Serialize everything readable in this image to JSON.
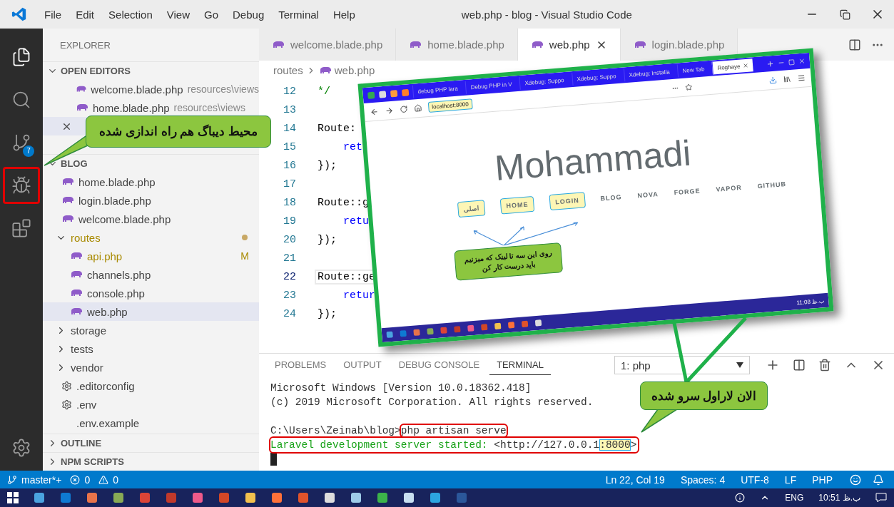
{
  "title_bar": {
    "menu": [
      "File",
      "Edit",
      "Selection",
      "View",
      "Go",
      "Debug",
      "Terminal",
      "Help"
    ],
    "title": "web.php - blog - Visual Studio Code"
  },
  "activity_bar": [
    {
      "kind": "explorer",
      "selected": true,
      "highlighted": false
    },
    {
      "kind": "search",
      "selected": false,
      "highlighted": false
    },
    {
      "kind": "source_control",
      "selected": false,
      "highlighted": false,
      "badge": "7"
    },
    {
      "kind": "debug",
      "selected": false,
      "highlighted": true
    },
    {
      "kind": "extensions",
      "selected": false,
      "highlighted": false
    },
    {
      "kind": "settings",
      "selected": false,
      "highlighted": false
    }
  ],
  "sidebar": {
    "title": "EXPLORER",
    "sections": [
      {
        "kind": "editors",
        "label": "OPEN EDITORS",
        "expanded": true,
        "items": [
          {
            "name": "welcome.blade.php",
            "path": "resources\\views",
            "selected": false
          },
          {
            "name": "home.blade.php",
            "path": "resources\\views",
            "selected": false
          },
          {
            "kind": "covered",
            "selected": true
          }
        ]
      },
      {
        "kind": "tree",
        "label": "BLOG",
        "expanded": true,
        "children": [
          {
            "kind": "php",
            "name": "home.blade.php",
            "selected": false
          },
          {
            "kind": "php",
            "name": "login.blade.php",
            "selected": false
          },
          {
            "kind": "php",
            "name": "welcome.blade.php",
            "selected": false
          },
          {
            "kind": "folder",
            "name": "routes",
            "expanded": true,
            "modified": true,
            "selected": false,
            "children": [
              {
                "kind": "php",
                "name": "api.php",
                "status": "M",
                "selected": false
              },
              {
                "kind": "php",
                "name": "channels.php",
                "selected": false
              },
              {
                "kind": "php",
                "name": "console.php",
                "selected": false
              },
              {
                "kind": "php",
                "name": "web.php",
                "selected": true
              }
            ]
          },
          {
            "kind": "folder",
            "name": "storage",
            "expanded": false,
            "modified": false,
            "selected": false
          },
          {
            "kind": "folder",
            "name": "tests",
            "expanded": false,
            "modified": false,
            "selected": false
          },
          {
            "kind": "folder",
            "name": "vendor",
            "expanded": false,
            "modified": false,
            "selected": false
          },
          {
            "kind": "config",
            "name": ".editorconfig",
            "selected": false
          },
          {
            "kind": "config",
            "name": ".env",
            "selected": false
          },
          {
            "kind": "plain",
            "name": ".env.example",
            "selected": false
          }
        ]
      },
      {
        "kind": "collapsed",
        "label": "OUTLINE",
        "expanded": false
      },
      {
        "kind": "collapsed",
        "label": "NPM SCRIPTS",
        "expanded": false
      }
    ]
  },
  "editor": {
    "tabs": [
      {
        "label": "welcome.blade.php",
        "selected": false
      },
      {
        "label": "home.blade.php",
        "selected": false
      },
      {
        "label": "web.php",
        "selected": true
      },
      {
        "label": "login.blade.php",
        "selected": false
      }
    ],
    "breadcrumb": [
      "routes",
      "web.php"
    ],
    "lines": [
      {
        "number": "12",
        "text": "*/",
        "kind": "comment",
        "current": false
      },
      {
        "number": "13",
        "kind": "blank",
        "current": false
      },
      {
        "number": "14",
        "text": "Route:",
        "kind": "plain",
        "current": false
      },
      {
        "number": "15",
        "text": "    ret",
        "kind": "keyword",
        "current": false
      },
      {
        "number": "16",
        "text": "});",
        "kind": "plain",
        "current": false
      },
      {
        "number": "17",
        "kind": "blank",
        "current": false
      },
      {
        "number": "18",
        "text": "Route::g",
        "kind": "plain",
        "current": false
      },
      {
        "number": "19",
        "text": "    retu",
        "kind": "keyword",
        "current": false
      },
      {
        "number": "20",
        "text": "});",
        "kind": "plain",
        "current": false
      },
      {
        "number": "21",
        "kind": "blank",
        "current": false
      },
      {
        "number": "22",
        "text": "Route::ge",
        "kind": "plain",
        "current": true
      },
      {
        "number": "23",
        "text": "    retur",
        "kind": "keyword",
        "current": false
      },
      {
        "number": "24",
        "text": "});",
        "kind": "plain",
        "current": false
      }
    ]
  },
  "panel": {
    "tabs": [
      {
        "label": "PROBLEMS",
        "selected": false
      },
      {
        "label": "OUTPUT",
        "selected": false
      },
      {
        "label": "DEBUG CONSOLE",
        "selected": false
      },
      {
        "label": "TERMINAL",
        "selected": true
      }
    ],
    "terminal_select": "1: php",
    "lines": [
      {
        "kind": "output",
        "highlighted": false,
        "segments": [
          {
            "text": "Microsoft Windows [Version 10.0.18362.418]",
            "kind": "plain",
            "highlighted": false
          }
        ]
      },
      {
        "kind": "output",
        "highlighted": false,
        "segments": [
          {
            "text": "(c) 2019 Microsoft Corporation. All rights reserved.",
            "kind": "plain",
            "highlighted": false
          }
        ]
      },
      {
        "kind": "blank"
      },
      {
        "kind": "output",
        "highlighted": false,
        "segments": [
          {
            "text": "C:\\Users\\Zeinab\\blog>",
            "kind": "plain",
            "highlighted": false
          },
          {
            "text": "php artisan serve",
            "kind": "plain",
            "highlighted": true
          }
        ]
      },
      {
        "kind": "output",
        "highlighted": true,
        "segments": [
          {
            "text": "Laravel development server started: ",
            "kind": "success",
            "highlighted": false
          },
          {
            "text": "<http://127.0.0.1",
            "kind": "plain",
            "highlighted": false
          },
          {
            "text": ":8000",
            "kind": "marked",
            "highlighted": false
          },
          {
            "text": ">",
            "kind": "plain",
            "highlighted": false
          }
        ]
      },
      {
        "kind": "cursor"
      }
    ]
  },
  "status_bar": {
    "branch": "master*+",
    "errors": "0",
    "warnings": "0",
    "right": [
      "Ln 22, Col 19",
      "Spaces: 4",
      "UTF-8",
      "LF",
      "PHP"
    ]
  },
  "taskbar": {
    "language": "ENG",
    "clock": "10:51 ب.ظ"
  },
  "annotations": [
    {
      "kind": "sidebar",
      "text": "محیط دیباگ هم راه اندازی شده"
    },
    {
      "kind": "terminal",
      "text": "الان لاراول سرو شده"
    }
  ],
  "browser": {
    "tabs": [
      {
        "label": "debug PHP lara",
        "selected": false
      },
      {
        "label": "Debug PHP in V",
        "selected": false
      },
      {
        "label": "Xdebug: Suppo",
        "selected": false
      },
      {
        "label": "Xdebug: Suppo",
        "selected": false
      },
      {
        "label": "Xdebug: Installa",
        "selected": false
      },
      {
        "label": "New Tab",
        "selected": false
      },
      {
        "label": "Roghaye",
        "selected": true
      }
    ],
    "url": {
      "text": "localhost:8000",
      "highlighted": true
    },
    "page_title": "Mohammadi",
    "links": [
      {
        "label": "اصلی",
        "highlighted": true
      },
      {
        "label": "HOME",
        "highlighted": true
      },
      {
        "label": "LOGIN",
        "highlighted": true
      },
      {
        "label": "BLOG",
        "highlighted": false
      },
      {
        "label": "NOVA",
        "highlighted": false
      },
      {
        "label": "FORGE",
        "highlighted": false
      },
      {
        "label": "VAPOR",
        "highlighted": false
      },
      {
        "label": "GITHUB",
        "highlighted": false
      }
    ],
    "callout": "روی این سه تا لینک که میزنیم\nباید درست کار کن",
    "clock": "11:08 ب.ظ"
  }
}
